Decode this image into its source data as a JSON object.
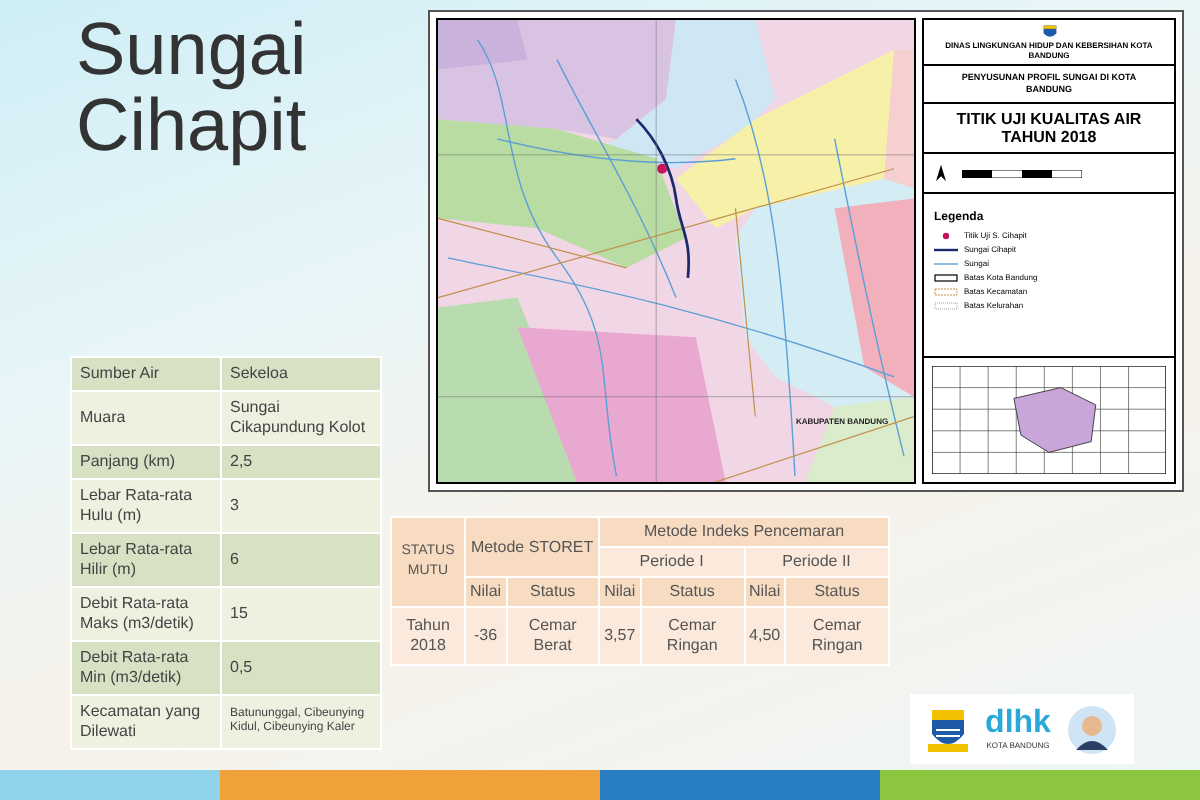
{
  "title": "Sungai Cihapit",
  "map": {
    "header": "DINAS LINGKUNGAN HIDUP DAN KEBERSIHAN KOTA BANDUNG",
    "project": "PENYUSUNAN PROFIL SUNGAI DI KOTA BANDUNG",
    "map_title": "TITIK UJI KUALITAS AIR TAHUN 2018",
    "area_label": "KABUPATEN BANDUNG",
    "legend_title": "Legenda",
    "legend": [
      {
        "kind": "point",
        "label": "Titik Uji S. Cihapit"
      },
      {
        "kind": "main-river",
        "label": "Sungai Cihapit"
      },
      {
        "kind": "river",
        "label": "Sungai"
      },
      {
        "kind": "city",
        "label": "Batas Kota Bandung"
      },
      {
        "kind": "district",
        "label": "Batas Kecamatan"
      },
      {
        "kind": "village",
        "label": "Batas Kelurahan"
      }
    ]
  },
  "profile": [
    {
      "label": "Sumber Air",
      "value": "Sekeloa"
    },
    {
      "label": "Muara",
      "value": "Sungai Cikapundung Kolot"
    },
    {
      "label": "Panjang (km)",
      "value": "2,5"
    },
    {
      "label": "Lebar Rata-rata Hulu (m)",
      "value": "3"
    },
    {
      "label": "Lebar Rata-rata Hilir (m)",
      "value": "6"
    },
    {
      "label": "Debit Rata-rata Maks (m3/detik)",
      "value": "15"
    },
    {
      "label": "Debit Rata-rata Min (m3/detik)",
      "value": "0,5"
    },
    {
      "label": "Kecamatan yang Dilewati",
      "value": "Batununggal, Cibeunying Kidul, Cibeunying Kaler"
    }
  ],
  "quality": {
    "status_header": "STATUS MUTU",
    "storet_header": "Metode STORET",
    "ip_header": "Metode Indeks Pencemaran",
    "periods": [
      "Periode I",
      "Periode II"
    ],
    "subheaders": [
      "Nilai",
      "Status",
      "Nilai",
      "Status",
      "Nilai",
      "Status"
    ],
    "row": {
      "label": "Tahun 2018",
      "cells": [
        "-36",
        "Cemar Berat",
        "3,57",
        "Cemar Ringan",
        "4,50",
        "Cemar Ringan"
      ]
    }
  },
  "logos": {
    "agency": "dlhk",
    "agency_city": "KOTA BANDUNG"
  }
}
